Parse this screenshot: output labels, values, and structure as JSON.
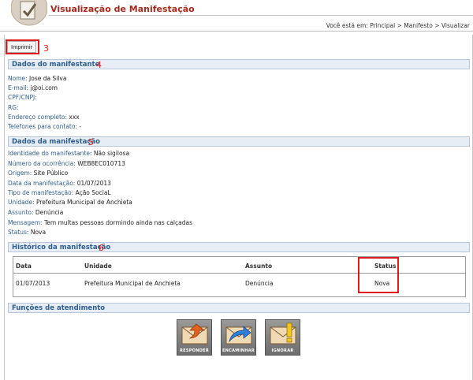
{
  "header": {
    "title": "Visualização de Manifestação",
    "breadcrumb_prefix": "Você está em:",
    "breadcrumb": [
      "Principal",
      "Manifesto",
      "Visualizar"
    ],
    "logo_icon": "document-check-icon"
  },
  "toolbar": {
    "print_label": "Imprimir"
  },
  "annotations": {
    "print": "3",
    "manifestante": "4",
    "manifestacao": "5",
    "historico": "6",
    "color": "#e01b1b"
  },
  "manifestante": {
    "title": "Dados do manifestante",
    "fields": [
      {
        "label": "Nome:",
        "value": "Jose da Silva"
      },
      {
        "label": "E-mail:",
        "value": "j@oi.com"
      },
      {
        "label": "CPF/CNPJ:",
        "value": ""
      },
      {
        "label": "RG:",
        "value": ""
      },
      {
        "label": "Endereço completo:",
        "value": "xxx"
      },
      {
        "label": "Telefones para contato:",
        "value": "-"
      }
    ]
  },
  "manifestacao": {
    "title": "Dados da manifestação",
    "fields": [
      {
        "label": "Identidade do manifestante:",
        "value": "Não sigilosa"
      },
      {
        "label": "Número da ocorrência:",
        "value": "WEB8EC010713"
      },
      {
        "label": "Origem:",
        "value": "Site Público"
      },
      {
        "label": "Data da manifestação:",
        "value": "01/07/2013"
      },
      {
        "label": "Tipo de manifestação:",
        "value": "Ação SociaL"
      },
      {
        "label": "Unidade:",
        "value": "Prefeitura Municipal de Anchieta"
      },
      {
        "label": "Assunto:",
        "value": "Denúncia"
      },
      {
        "label": "Mensagem:",
        "value": "Tem multas pessoas dormindo ainda nas calçadas"
      },
      {
        "label": "Status:",
        "value": "Nova"
      }
    ]
  },
  "historico": {
    "title": "Histórico da manifestação",
    "columns": [
      "Data",
      "Unidade",
      "Assunto",
      "Status"
    ],
    "rows": [
      {
        "data": "01/07/2013",
        "unidade": "Prefeitura Municipal de Anchieta",
        "assunto": "Denúncia",
        "status": "Nova"
      }
    ]
  },
  "funcoes": {
    "title": "Funções de atendimento",
    "buttons": [
      {
        "label": "RESPONDER",
        "icon": "envelope-reply-icon"
      },
      {
        "label": "ENCAMINHAR",
        "icon": "envelope-forward-icon"
      },
      {
        "label": "IGNORAR",
        "icon": "envelope-ignore-icon"
      }
    ]
  },
  "colors": {
    "accent": "#a52a1e",
    "section": "#2f5e8e",
    "header_bg": "#e6edf5"
  }
}
